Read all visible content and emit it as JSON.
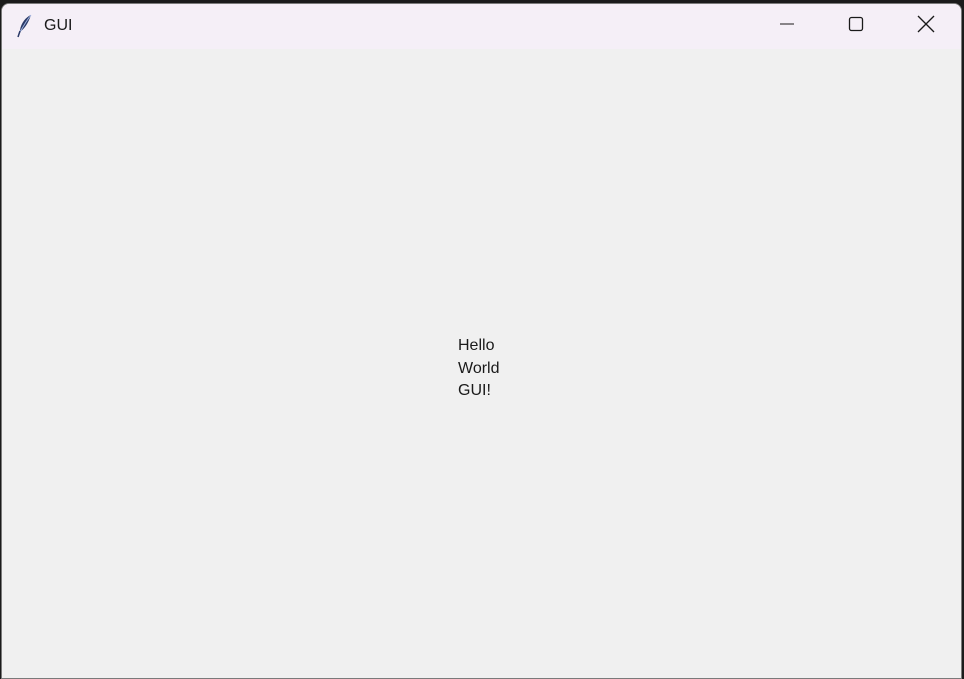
{
  "window": {
    "title": "GUI",
    "app_icon": "feather-icon"
  },
  "titlebar_controls": {
    "minimize_icon": "minimize-icon",
    "maximize_icon": "maximize-icon",
    "close_icon": "close-icon"
  },
  "content": {
    "label_text": "Hello\nWorld\nGUI!"
  },
  "colors": {
    "titlebar_bg": "#f5eff7",
    "client_bg": "#f0f0f0",
    "text": "#1a1a1a"
  }
}
